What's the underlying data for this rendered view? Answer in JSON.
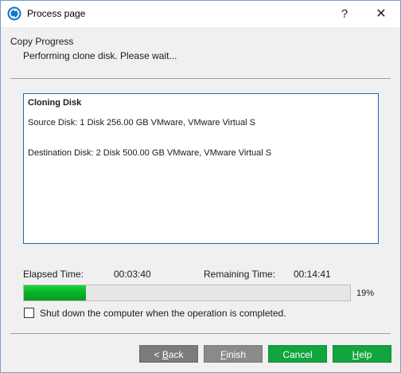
{
  "window": {
    "title": "Process page",
    "help_glyph": "?",
    "close_glyph": "✕"
  },
  "header": {
    "title": "Copy Progress",
    "subtitle": "Performing clone disk. Please wait..."
  },
  "log": {
    "heading": "Cloning Disk",
    "source": "Source Disk: 1 Disk 256.00 GB VMware, VMware Virtual S",
    "destination": "Destination Disk: 2 Disk 500.00 GB VMware, VMware Virtual S"
  },
  "progress": {
    "elapsed_label": "Elapsed Time:",
    "elapsed_value": "00:03:40",
    "remaining_label": "Remaining Time:",
    "remaining_value": "00:14:41",
    "percent": 19,
    "percent_text": "19%"
  },
  "options": {
    "shutdown_label": "Shut down the computer when the operation is completed.",
    "shutdown_checked": false
  },
  "footer": {
    "back_prefix": "< ",
    "back_underline": "B",
    "back_rest": "ack",
    "finish_underline": "F",
    "finish_rest": "inish",
    "cancel_label": "Cancel",
    "help_underline": "H",
    "help_rest": "elp"
  },
  "colors": {
    "progress_fill": "#06b025",
    "primary_button": "#12a43f",
    "disabled_button": "#7b7b7b",
    "log_border": "#1e67b0"
  },
  "icons": {
    "app": "app-logo-icon",
    "help": "help-icon",
    "close": "close-icon"
  }
}
